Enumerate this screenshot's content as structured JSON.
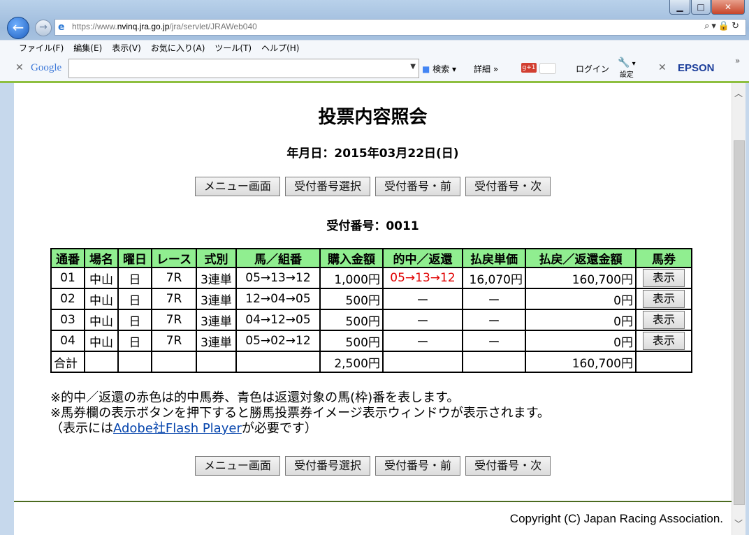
{
  "browser": {
    "url_prefix": "https://www.",
    "url_host": "nvinq.jra.go.jp",
    "url_path": "/jra/servlet/JRAWeb040",
    "menu": [
      "ファイル(F)",
      "編集(E)",
      "表示(V)",
      "お気に入り(A)",
      "ツール(T)",
      "ヘルプ(H)"
    ],
    "google_logo": "Google",
    "search_label": "検索",
    "detail_label": "詳細",
    "login_label": "ログイン",
    "settings_label": "設定",
    "epson_label": "EPSON"
  },
  "page": {
    "title": "投票内容照会",
    "date": "年月日：2015年03月22日(日)",
    "buttons": {
      "menu": "メニュー画面",
      "select": "受付番号選択",
      "prev": "受付番号・前",
      "next": "受付番号・次"
    },
    "receipt_no": "受付番号：0011"
  },
  "table": {
    "headers": [
      "通番",
      "場名",
      "曜日",
      "レース",
      "式別",
      "馬／組番",
      "購入金額",
      "的中／返還",
      "払戻単価",
      "払戻／返還金額",
      "馬券"
    ],
    "rows": [
      {
        "no": "01",
        "place": "中山",
        "day": "日",
        "race": "7R",
        "type": "3連単",
        "combo": "05→13→12",
        "amount": "1,000円",
        "hit": "05→13→12",
        "unit": "16,070円",
        "payout": "160,700円",
        "btn": "表示"
      },
      {
        "no": "02",
        "place": "中山",
        "day": "日",
        "race": "7R",
        "type": "3連単",
        "combo": "12→04→05",
        "amount": "500円",
        "hit": "ー",
        "unit": "ー",
        "payout": "0円",
        "btn": "表示"
      },
      {
        "no": "03",
        "place": "中山",
        "day": "日",
        "race": "7R",
        "type": "3連単",
        "combo": "04→12→05",
        "amount": "500円",
        "hit": "ー",
        "unit": "ー",
        "payout": "0円",
        "btn": "表示"
      },
      {
        "no": "04",
        "place": "中山",
        "day": "日",
        "race": "7R",
        "type": "3連単",
        "combo": "05→02→12",
        "amount": "500円",
        "hit": "ー",
        "unit": "ー",
        "payout": "0円",
        "btn": "表示"
      }
    ],
    "total_label": "合計",
    "total_amount": "2,500円",
    "total_payout": "160,700円"
  },
  "notes": {
    "line1": "※的中／返還の赤色は的中馬券、青色は返還対象の馬(枠)番を表します。",
    "line2": "※馬券欄の表示ボタンを押下すると勝馬投票券イメージ表示ウィンドウが表示されます。",
    "line3_pre": "（表示には",
    "line3_link": "Adobe社Flash Player",
    "line3_post": "が必要です）"
  },
  "footer": {
    "copyright": "Copyright (C) Japan Racing Association."
  },
  "colors": {
    "header_bg": "#90ee90",
    "hit_red": "#e00000",
    "footer_rule": "#4b6b1f"
  }
}
